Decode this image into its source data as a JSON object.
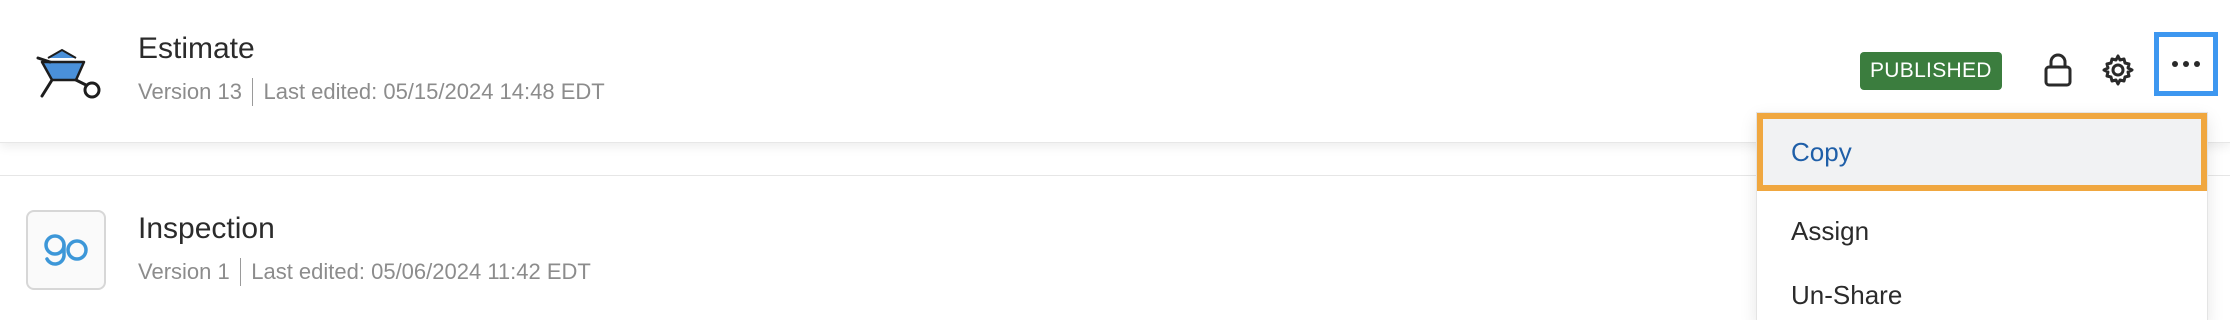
{
  "rows": [
    {
      "title": "Estimate",
      "version": "Version 13",
      "last_edited": "Last edited: 05/15/2024 14:48 EDT",
      "icon": "wheelbarrow-icon",
      "status": "PUBLISHED"
    },
    {
      "title": "Inspection",
      "version": "Version 1",
      "last_edited": "Last edited: 05/06/2024 11:42 EDT",
      "icon": "go-logo-icon"
    }
  ],
  "toolbar": {
    "lock_icon": "lock-icon",
    "gear_icon": "gear-icon",
    "more_icon": "more-horizontal-icon"
  },
  "menu": {
    "items": [
      "Copy",
      "Assign",
      "Un-Share"
    ]
  },
  "colors": {
    "published_badge": "#3b7d3e",
    "highlight_more": "#3d97f0",
    "highlight_copy": "#f0a73f",
    "copy_text": "#1f5fa8",
    "go_logo": "#3d97d8"
  }
}
